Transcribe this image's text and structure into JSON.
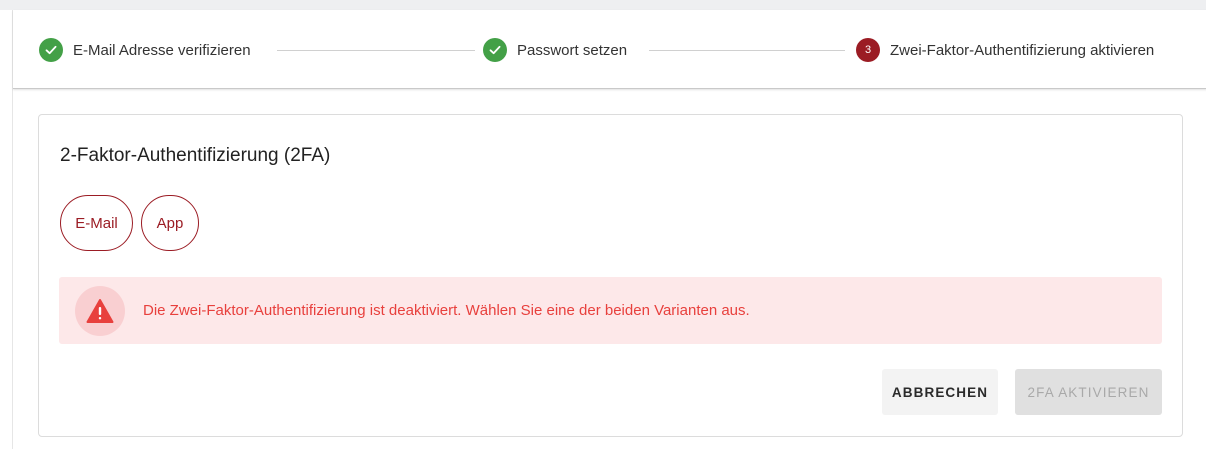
{
  "stepper": {
    "steps": [
      {
        "label": "E-Mail Adresse verifizieren",
        "state": "done"
      },
      {
        "label": "Passwort setzen",
        "state": "done"
      },
      {
        "label": "Zwei-Faktor-Authentifizierung aktivieren",
        "state": "active",
        "number": "3"
      }
    ]
  },
  "card": {
    "title": "2-Faktor-Authentifizierung (2FA)",
    "options": [
      {
        "label": "E-Mail"
      },
      {
        "label": "App"
      }
    ],
    "alert": {
      "icon": "warning-triangle-icon",
      "text": "Die Zwei-Faktor-Authentifizierung ist deaktiviert. Wählen Sie eine der beiden Varianten aus."
    },
    "actions": {
      "cancel_label": "ABBRECHEN",
      "activate_label": "2FA AKTIVIEREN",
      "activate_enabled": false
    }
  },
  "colors": {
    "accent": "#9b1c24",
    "success": "#43a047",
    "alert_bg": "#fde8e9",
    "alert_text": "#e8403d"
  }
}
